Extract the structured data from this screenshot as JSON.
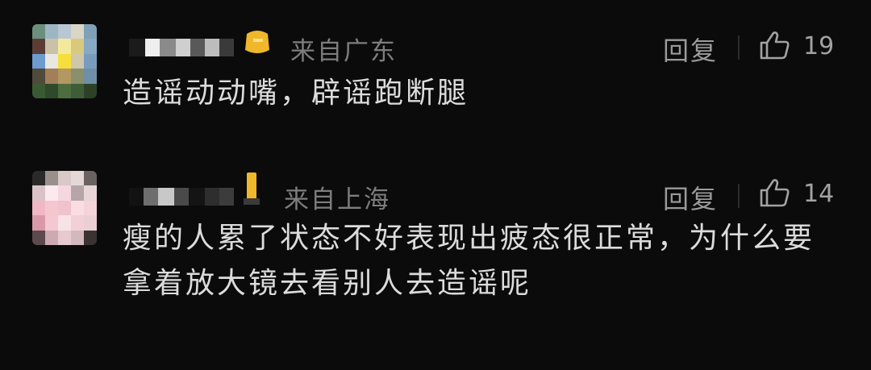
{
  "comments": [
    {
      "location": "来自广东",
      "text": "造谣动动嘴，辟谣跑断腿",
      "reply_label": "回复",
      "likes": "19",
      "badge_color": "#f0b72b"
    },
    {
      "location": "来自上海",
      "text": "瘦的人累了状态不好表现出疲态很正常，为什么要拿着放大镜去看别人去造谣呢",
      "reply_label": "回复",
      "likes": "14",
      "badge_color": "#f0b72b"
    }
  ],
  "icons": {
    "like": "thumbs-up-outline-icon",
    "badge": "vip-badge-icon"
  }
}
